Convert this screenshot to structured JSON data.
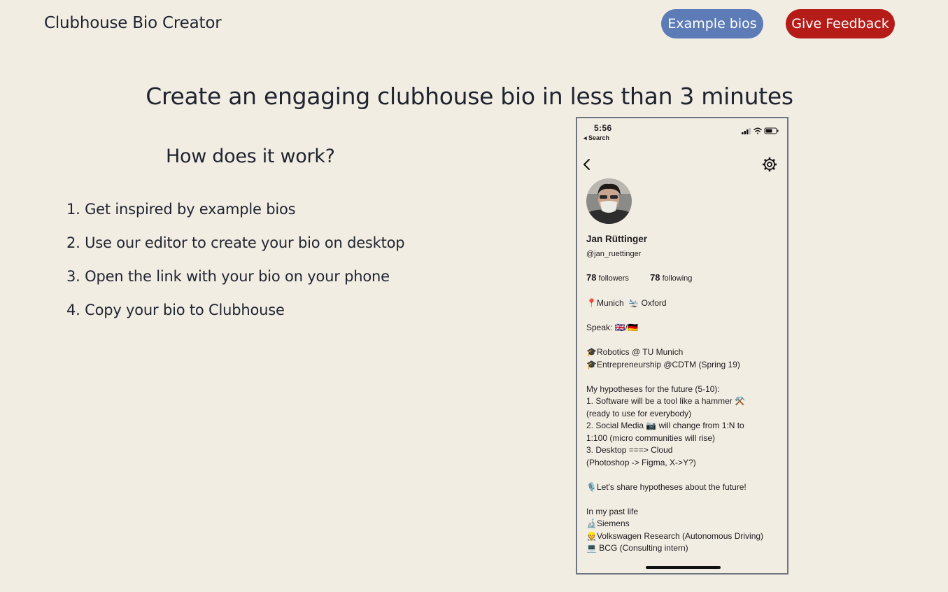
{
  "header": {
    "app_title": "Clubhouse Bio Creator",
    "example_bios_label": "Example bios",
    "feedback_label": "Give Feedback"
  },
  "colors": {
    "background": "#f2ede3",
    "example_button": "#5d7bb6",
    "feedback_button": "#b51c17"
  },
  "main": {
    "headline": "Create an engaging clubhouse bio in less than 3 minutes",
    "how_title": "How does it work?",
    "steps": [
      "1. Get inspired by example bios",
      "2. Use our editor to create your bio on desktop",
      "3. Open the link with your bio on your phone",
      "4. Copy your bio to Clubhouse"
    ]
  },
  "phone": {
    "time": "5:56",
    "back_app": "◂ Search",
    "icons": [
      "signal-icon",
      "wifi-icon",
      "battery-icon",
      "back-chevron-icon",
      "settings-gear-icon"
    ],
    "name": "Jan Rüttinger",
    "handle": "@jan_ruettinger",
    "followers_count": "78",
    "followers_label": "followers",
    "following_count": "78",
    "following_label": "following",
    "bio": "📍Munich  🛬 Oxford\n\nSpeak: 🇬🇧/🇩🇪\n\n🎓Robotics @ TU Munich\n🎓Entrepreneurship @CDTM (Spring 19)\n\nMy hypotheses for the future (5-10):\n1. Software will be a tool like a hammer ⚒️\n(ready to use for everybody)\n2. Social Media 📷 will change from 1:N to\n1:100 (micro communities will rise)\n3. Desktop ===> Cloud\n(Photoshop -> Figma, X->Y?)\n\n🎙️Let's share hypotheses about the future!\n\nIn my past life\n🔬Siemens\n👷Volkswagen Research (Autonomous Driving)\n💻 BCG (Consulting intern)"
  }
}
